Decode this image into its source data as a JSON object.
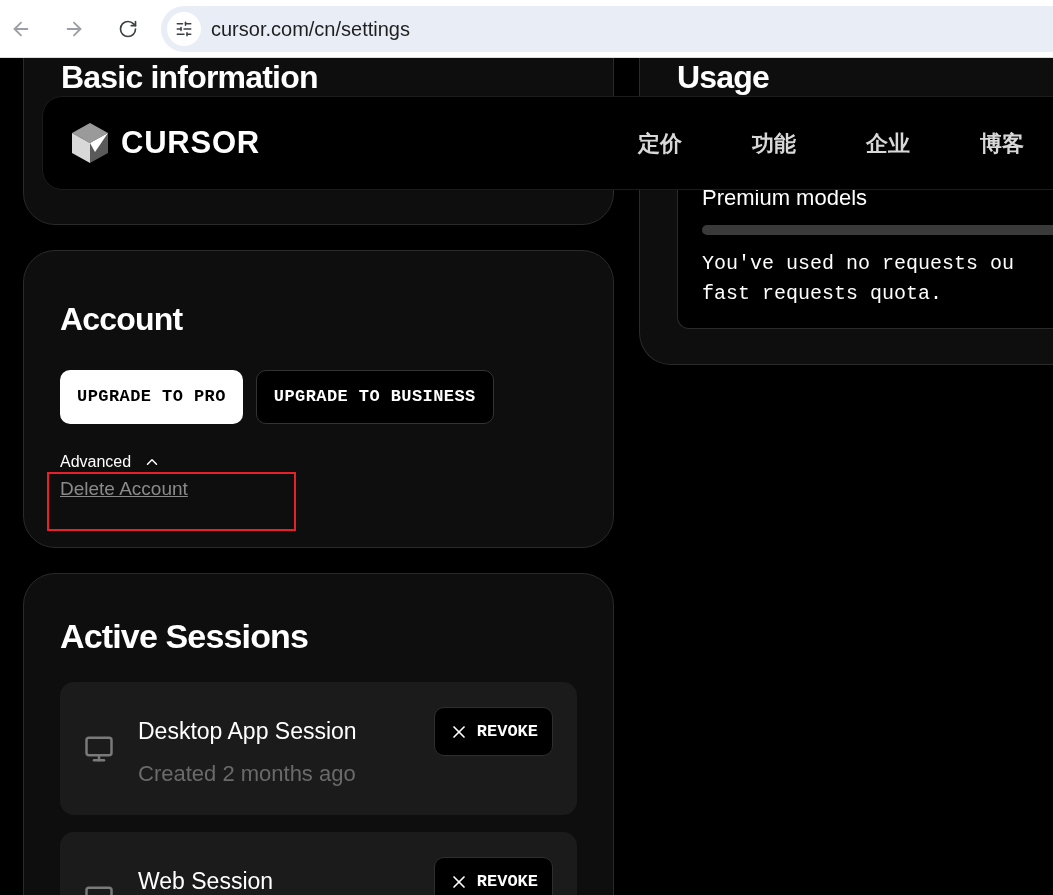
{
  "browser": {
    "url": "cursor.com/cn/settings"
  },
  "nav": {
    "logo": "CURSOR",
    "links": [
      "定价",
      "功能",
      "企业",
      "博客"
    ]
  },
  "basic_information": {
    "title": "Basic information"
  },
  "account": {
    "title": "Account",
    "buttons": [
      {
        "label": "UPGRADE TO PRO",
        "kind": "primary"
      },
      {
        "label": "UPGRADE TO BUSINESS",
        "kind": "secondary"
      }
    ],
    "advanced": {
      "label": "Advanced",
      "expanded": true
    },
    "delete_link": "Delete Account"
  },
  "active_sessions": {
    "title": "Active Sessions",
    "sessions": [
      {
        "name": "Desktop App Session",
        "created": "Created 2 months ago",
        "action": "REVOKE"
      },
      {
        "name": "Web Session",
        "action": "REVOKE"
      }
    ]
  },
  "usage": {
    "title": "Usage",
    "premium_models": {
      "label": "Premium models",
      "level": 0,
      "note_lines": [
        "You've used no requests ou",
        "fast requests quota."
      ]
    }
  }
}
